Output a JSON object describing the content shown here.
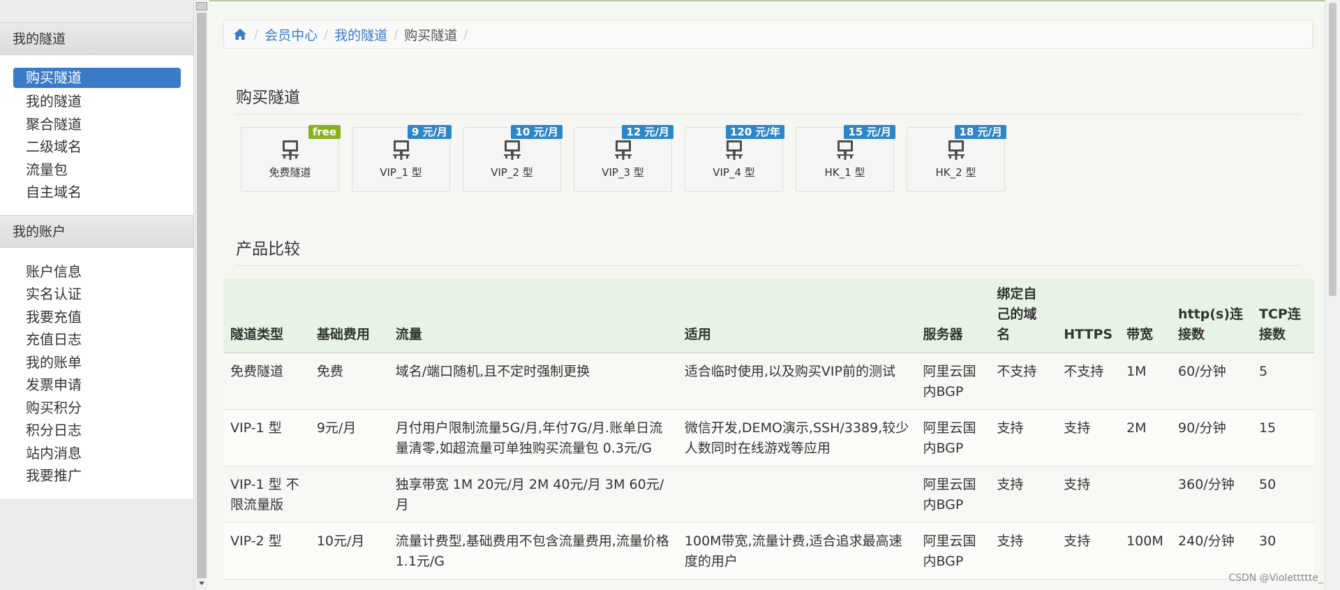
{
  "sidebar": {
    "groups": [
      {
        "title": "我的隧道",
        "items": [
          "购买隧道",
          "我的隧道",
          "聚合隧道",
          "二级域名",
          "流量包",
          "自主域名"
        ]
      },
      {
        "title": "我的账户",
        "items": [
          "账户信息",
          "实名认证",
          "我要充值",
          "充值日志",
          "我的账单",
          "发票申请",
          "购买积分",
          "积分日志",
          "站内消息",
          "我要推广"
        ]
      }
    ]
  },
  "breadcrumb": {
    "items": [
      "会员中心",
      "我的隧道",
      "购买隧道"
    ]
  },
  "buy_section": {
    "title": "购买隧道",
    "cards": [
      {
        "label": "免费隧道",
        "badge": "free"
      },
      {
        "label": "VIP_1 型",
        "badge": "9 元/月"
      },
      {
        "label": "VIP_2 型",
        "badge": "10 元/月"
      },
      {
        "label": "VIP_3 型",
        "badge": "12 元/月"
      },
      {
        "label": "VIP_4 型",
        "badge": "120 元/年"
      },
      {
        "label": "HK_1 型",
        "badge": "15 元/月"
      },
      {
        "label": "HK_2 型",
        "badge": "18 元/月"
      }
    ]
  },
  "compare_section": {
    "title": "产品比较",
    "headers": [
      "隧道类型",
      "基础费用",
      "流量",
      "适用",
      "服务器",
      "绑定自己的域名",
      "HTTPS",
      "带宽",
      "http(s)连接数",
      "TCP连接数"
    ],
    "rows": [
      [
        "免费隧道",
        "免费",
        "域名/端口随机,且不定时强制更换",
        "适合临时使用,以及购买VIP前的测试",
        "阿里云国内BGP",
        "不支持",
        "不支持",
        "1M",
        "60/分钟",
        "5"
      ],
      [
        "VIP-1 型",
        "9元/月",
        "月付用户限制流量5G/月,年付7G/月.账单日流量清零,如超流量可单独购买流量包 0.3元/G",
        "微信开发,DEMO演示,SSH/3389,较少人数同时在线游戏等应用",
        "阿里云国内BGP",
        "支持",
        "支持",
        "2M",
        "90/分钟",
        "15"
      ],
      [
        "VIP-1 型 不限流量版",
        "",
        "独享带宽 1M 20元/月 2M 40元/月 3M 60元/月",
        "",
        "阿里云国内BGP",
        "支持",
        "支持",
        "",
        "360/分钟",
        "50"
      ],
      [
        "VIP-2 型",
        "10元/月",
        "流量计费型,基础费用不包含流量费用,流量价格1.1元/G",
        "100M带宽,流量计费,适合追求最高速度的用户",
        "阿里云国内BGP",
        "支持",
        "支持",
        "100M",
        "240/分钟",
        "30"
      ]
    ]
  },
  "watermark": "CSDN @Violettttte_",
  "colors": {
    "accent": "#3a7bc8",
    "badge_blue": "#2d86c5",
    "badge_free": "#87b11e",
    "table_header_bg": "#e7f3e5"
  },
  "icons": {
    "breadcrumb_home": "home-icon",
    "card": "monitor-network-icon"
  }
}
